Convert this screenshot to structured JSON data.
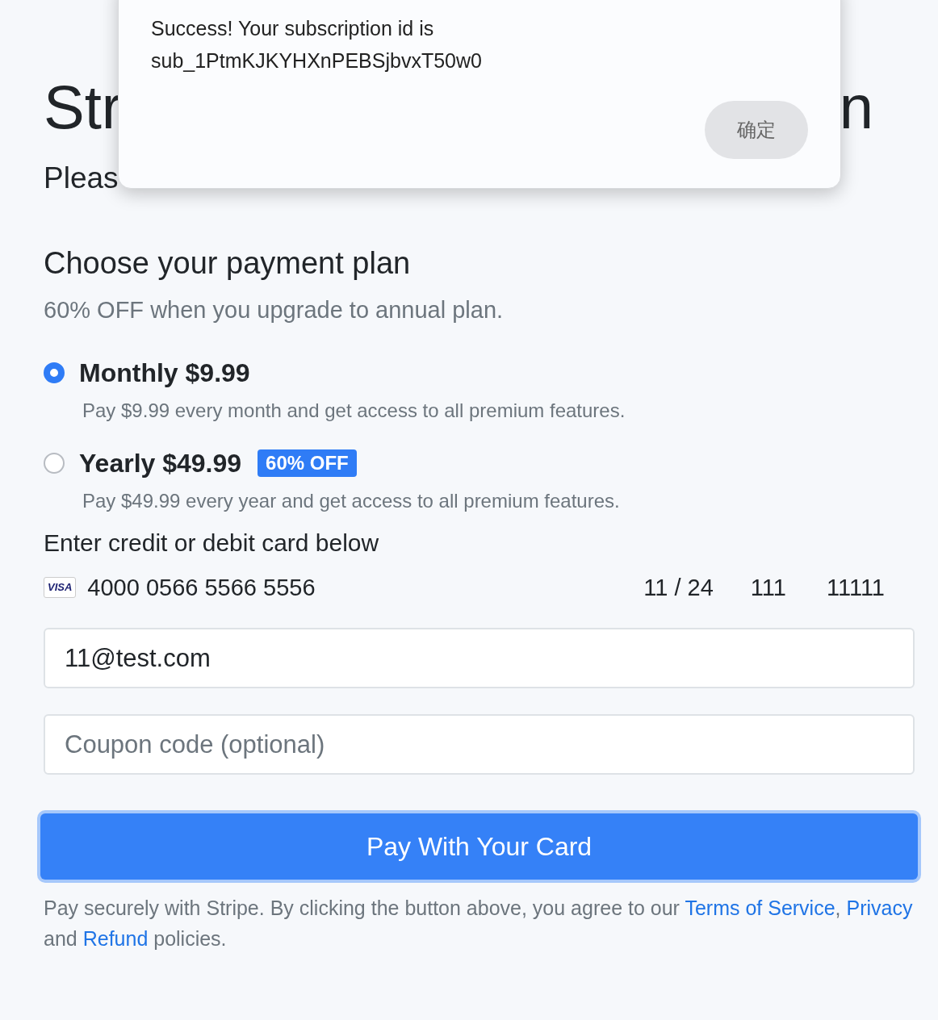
{
  "title": {
    "visible_start": "Str",
    "visible_end": "n"
  },
  "subtitle": "Pleas",
  "dialog": {
    "message": "Success! Your subscription id is",
    "subscription_id": "sub_1PtmKJKYHXnPEBSjbvxT50w0",
    "button": "确定"
  },
  "plan_section": {
    "heading": "Choose your payment plan",
    "note": "60% OFF when you upgrade to annual plan."
  },
  "plans": [
    {
      "label": "Monthly $9.99",
      "description": "Pay $9.99 every month and get access to all premium features.",
      "selected": true
    },
    {
      "label": "Yearly $49.99",
      "badge": "60% OFF",
      "description": "Pay $49.99 every year and get access to all premium features.",
      "selected": false
    }
  ],
  "card": {
    "heading": "Enter credit or debit card below",
    "brand": "VISA",
    "number": "4000 0566 5566 5556",
    "expiry": "11 / 24",
    "cvc": "111",
    "postal": "11111"
  },
  "email": {
    "value": "11@test.com"
  },
  "coupon": {
    "placeholder": "Coupon code (optional)"
  },
  "pay_button": "Pay With Your Card",
  "footer": {
    "text_1": "Pay securely with Stripe. By clicking the button above, you agree to our ",
    "link_terms": "Terms of Service",
    "text_2": ",",
    "link_privacy": "Privacy",
    "text_3": " and ",
    "link_refund": "Refund",
    "text_4": " policies."
  }
}
